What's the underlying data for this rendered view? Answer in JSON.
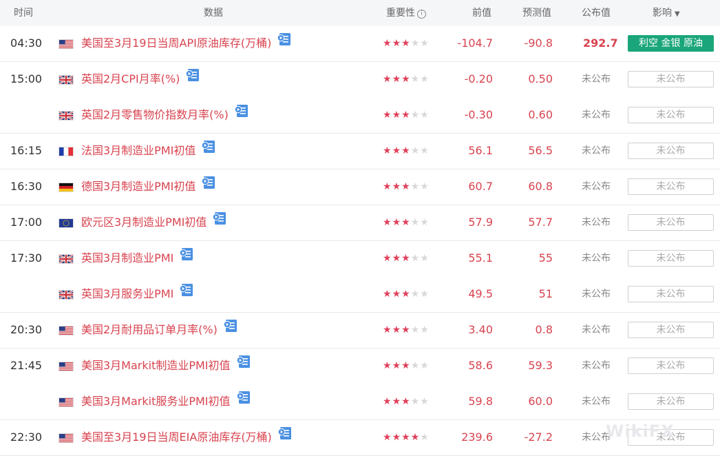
{
  "header": {
    "time": "时间",
    "data": "数据",
    "importance": "重要性",
    "previous": "前值",
    "forecast": "预测值",
    "actual": "公布值",
    "impact": "影响"
  },
  "watermark": "WikiFX",
  "colors": {
    "accent_red": "#d8434f",
    "star_on": "#e0405a",
    "star_off": "#d8d8d8",
    "impact_green": "#1aa67a",
    "header_bg": "#f5f6f8"
  },
  "rows": [
    {
      "time": "04:30",
      "flag": "us",
      "title": "美国至3月19日当周API原油库存(万桶)",
      "stars": 3,
      "previous": "-104.7",
      "forecast": "-90.8",
      "actual": "292.7",
      "actual_published": true,
      "impact": "利空 金银 原油",
      "impact_style": "green",
      "group_end": true
    },
    {
      "time": "15:00",
      "flag": "uk",
      "title": "英国2月CPI月率(%)",
      "stars": 3,
      "previous": "-0.20",
      "forecast": "0.50",
      "actual": "未公布",
      "actual_published": false,
      "impact": "未公布",
      "impact_style": "pending",
      "group_end": false
    },
    {
      "time": "",
      "flag": "uk",
      "title": "英国2月零售物价指数月率(%)",
      "stars": 3,
      "previous": "-0.30",
      "forecast": "0.60",
      "actual": "未公布",
      "actual_published": false,
      "impact": "未公布",
      "impact_style": "pending",
      "group_end": true
    },
    {
      "time": "16:15",
      "flag": "fr",
      "title": "法国3月制造业PMI初值",
      "stars": 3,
      "previous": "56.1",
      "forecast": "56.5",
      "actual": "未公布",
      "actual_published": false,
      "impact": "未公布",
      "impact_style": "pending",
      "group_end": true
    },
    {
      "time": "16:30",
      "flag": "de",
      "title": "德国3月制造业PMI初值",
      "stars": 3,
      "previous": "60.7",
      "forecast": "60.8",
      "actual": "未公布",
      "actual_published": false,
      "impact": "未公布",
      "impact_style": "pending",
      "group_end": true
    },
    {
      "time": "17:00",
      "flag": "eu",
      "title": "欧元区3月制造业PMI初值",
      "stars": 3,
      "previous": "57.9",
      "forecast": "57.7",
      "actual": "未公布",
      "actual_published": false,
      "impact": "未公布",
      "impact_style": "pending",
      "group_end": true
    },
    {
      "time": "17:30",
      "flag": "uk",
      "title": "英国3月制造业PMI",
      "stars": 3,
      "previous": "55.1",
      "forecast": "55",
      "actual": "未公布",
      "actual_published": false,
      "impact": "未公布",
      "impact_style": "pending",
      "group_end": false
    },
    {
      "time": "",
      "flag": "uk",
      "title": "英国3月服务业PMI",
      "stars": 3,
      "previous": "49.5",
      "forecast": "51",
      "actual": "未公布",
      "actual_published": false,
      "impact": "未公布",
      "impact_style": "pending",
      "group_end": true
    },
    {
      "time": "20:30",
      "flag": "us",
      "title": "美国2月耐用品订单月率(%)",
      "stars": 3,
      "previous": "3.40",
      "forecast": "0.8",
      "actual": "未公布",
      "actual_published": false,
      "impact": "未公布",
      "impact_style": "pending",
      "group_end": true
    },
    {
      "time": "21:45",
      "flag": "us",
      "title": "美国3月Markit制造业PMI初值",
      "stars": 3,
      "previous": "58.6",
      "forecast": "59.3",
      "actual": "未公布",
      "actual_published": false,
      "impact": "未公布",
      "impact_style": "pending",
      "group_end": false
    },
    {
      "time": "",
      "flag": "us",
      "title": "美国3月Markit服务业PMI初值",
      "stars": 3,
      "previous": "59.8",
      "forecast": "60.0",
      "actual": "未公布",
      "actual_published": false,
      "impact": "未公布",
      "impact_style": "pending",
      "group_end": true
    },
    {
      "time": "22:30",
      "flag": "us",
      "title": "美国至3月19日当周EIA原油库存(万桶)",
      "stars": 4,
      "previous": "239.6",
      "forecast": "-27.2",
      "actual": "未公布",
      "actual_published": false,
      "impact": "未公布",
      "impact_style": "pending",
      "group_end": true
    }
  ]
}
